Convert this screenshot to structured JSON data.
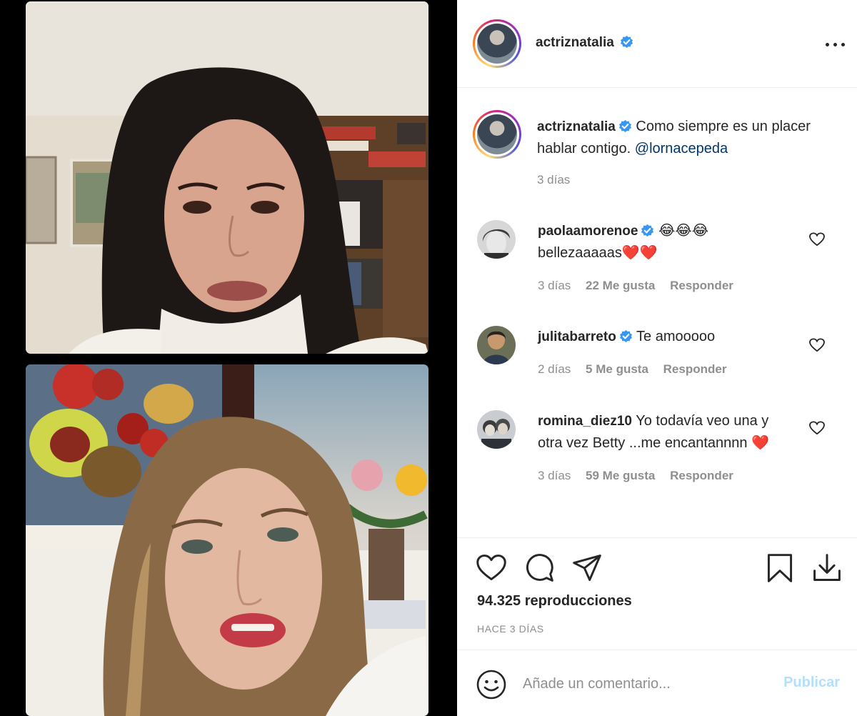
{
  "header": {
    "username": "actriznatalia"
  },
  "caption": {
    "username": "actriznatalia",
    "text": "Como siempre es un placer hablar contigo.",
    "mention": "@lornacepeda",
    "time": "3 días"
  },
  "comments": [
    {
      "username": "paolaamorenoe",
      "verified": true,
      "text": "😂😂😂 bellezaaaaas❤️❤️",
      "time": "3 días",
      "likes": "22 Me gusta",
      "reply": "Responder"
    },
    {
      "username": "julitabarreto",
      "verified": true,
      "text": "Te amooooo",
      "time": "2 días",
      "likes": "5 Me gusta",
      "reply": "Responder"
    },
    {
      "username": "romina_diez10",
      "verified": false,
      "text": "Yo todavía veo una y otra vez Betty ...me encantannnn ❤️",
      "time": "3 días",
      "likes": "59 Me gusta",
      "reply": "Responder"
    }
  ],
  "actions": {
    "views": "94.325 reproducciones",
    "date": "HACE 3 DÍAS"
  },
  "add_comment": {
    "placeholder": "Añade un comentario...",
    "publish_label": "Publicar"
  },
  "icons": {
    "like": "heart-icon",
    "comment": "comment-bubble-icon",
    "share": "paper-plane-icon",
    "save": "bookmark-icon",
    "download": "download-icon",
    "emoji": "smiley-icon",
    "more": "more-dots-icon",
    "verified": "verified-badge-icon"
  },
  "colors": {
    "verified_blue": "#3897f0",
    "link": "#00376b",
    "muted": "#8e8e8e",
    "publish_disabled": "#b2dffc",
    "heart_red": "#c0242b"
  }
}
